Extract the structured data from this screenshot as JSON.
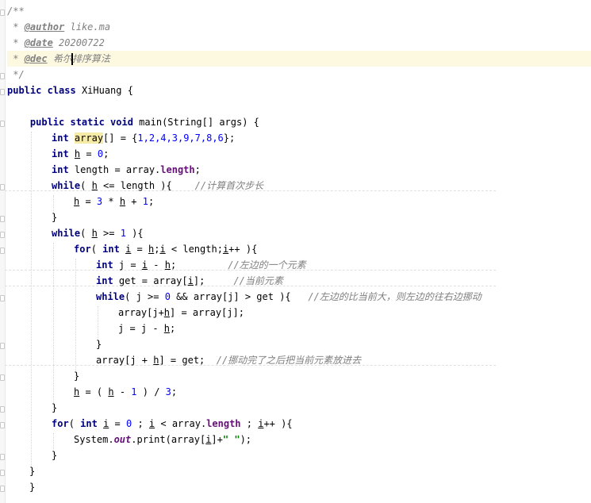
{
  "doc": {
    "open": "/**",
    "star": " * ",
    "author_tag": "@author",
    "author_val": " like.ma",
    "date_tag": "@date",
    "date_val": " 20200722",
    "dec_tag": "@dec",
    "dec_val_a": " 希尔",
    "dec_val_b": "排序算法",
    "close": " */"
  },
  "class_decl": {
    "kw_public": "public",
    "kw_class": " class ",
    "name": "XiHuang {"
  },
  "method": {
    "indent": "    ",
    "sig_kw": "public static void",
    "sig_rest": " main(String[] args) {"
  },
  "lines": {
    "l7_kw": "int",
    "l7_var": "array",
    "l7_rest": "[] = {",
    "l7_nums": "1,2,4,3,9,7,8,6",
    "l7_end": "};",
    "l8_kw": "int",
    "l8_var": "h",
    "l8_mid": " = ",
    "l8_num": "0",
    "l8_end": ";",
    "l9_kw": "int",
    "l9_rest": " length = array.",
    "l9_field": "length",
    "l9_end": ";",
    "l10_kw": "while",
    "l10_a": "( ",
    "l10_var": "h",
    "l10_b": " <= length ){    ",
    "l10_cmt": "//计算首次步长",
    "l11_a": "h",
    "l11_b": " = ",
    "l11_n1": "3",
    "l11_c": " * ",
    "l11_d": "h",
    "l11_e": " + ",
    "l11_n2": "1",
    "l11_f": ";",
    "l12": "}",
    "l13_kw": "while",
    "l13_a": "( ",
    "l13_var": "h",
    "l13_b": " >= ",
    "l13_num": "1",
    "l13_c": " ){",
    "l14_kw": "for",
    "l14_a": "( ",
    "l14_kw2": "int",
    "l14_b": " ",
    "l14_i": "i",
    "l14_c": " = ",
    "l14_h": "h",
    "l14_d": ";",
    "l14_i2": "i",
    "l14_e": " < length;",
    "l14_i3": "i",
    "l14_f": "++ ){",
    "l15_kw": "int",
    "l15_a": " j = ",
    "l15_i": "i",
    "l15_b": " - ",
    "l15_h": "h",
    "l15_c": ";         ",
    "l15_cmt": "//左边的一个元素",
    "l16_kw": "int",
    "l16_a": " get = array[",
    "l16_i": "i",
    "l16_b": "];     ",
    "l16_cmt": "//当前元素",
    "l17_kw": "while",
    "l17_a": "( j >= ",
    "l17_num": "0",
    "l17_b": " && array[j] > get ){   ",
    "l17_cmt": "//左边的比当前大，则左边的往右边挪动",
    "l18_a": "array[j+",
    "l18_h": "h",
    "l18_b": "] = array[j];",
    "l19_a": "j = j - ",
    "l19_h": "h",
    "l19_b": ";",
    "l20": "}",
    "l21_a": "array[j + ",
    "l21_h": "h",
    "l21_b": "] = get;  ",
    "l21_cmt": "//挪动完了之后把当前元素放进去",
    "l22": "}",
    "l23_a": "h",
    "l23_b": " = ( ",
    "l23_h": "h",
    "l23_c": " - ",
    "l23_n1": "1",
    "l23_d": " ) / ",
    "l23_n2": "3",
    "l23_e": ";",
    "l24": "}",
    "l25_kw": "for",
    "l25_a": "( ",
    "l25_kw2": "int",
    "l25_b": " ",
    "l25_i": "i",
    "l25_c": " = ",
    "l25_n": "0",
    "l25_d": " ; ",
    "l25_i2": "i",
    "l25_e": " < array.",
    "l25_field": "length",
    "l25_f": " ; ",
    "l25_i3": "i",
    "l25_g": "++ ){",
    "l26_a": "System.",
    "l26_out": "out",
    "l26_b": ".print(array[",
    "l26_i": "i",
    "l26_c": "]+",
    "l26_str": "\" \"",
    "l26_d": ");",
    "l27": "}",
    "l28": "}",
    "l29": "}"
  },
  "colors": {
    "keyword": "#000080",
    "number": "#0000ff",
    "comment": "#808080",
    "field": "#660e7a",
    "string": "#008000",
    "current_line": "#fdf8e0"
  }
}
